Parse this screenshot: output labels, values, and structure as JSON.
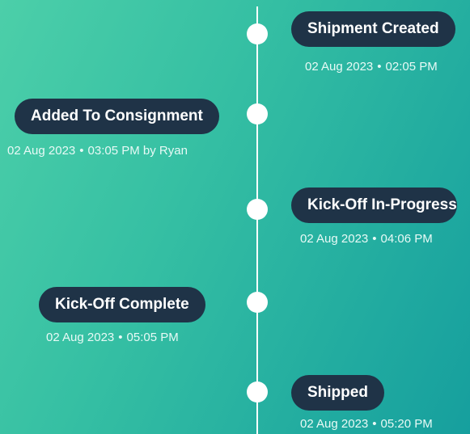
{
  "events": [
    {
      "status": "Shipment Created",
      "date": "02 Aug 2023",
      "time": "02:05 PM",
      "by": ""
    },
    {
      "status": "Added To Consignment",
      "date": "02 Aug 2023",
      "time": "03:05 PM",
      "by": "by Ryan"
    },
    {
      "status": "Kick-Off In-Progress",
      "date": "02 Aug 2023",
      "time": "04:06 PM",
      "by": ""
    },
    {
      "status": "Kick-Off Complete",
      "date": "02 Aug 2023",
      "time": "05:05 PM",
      "by": ""
    },
    {
      "status": "Shipped",
      "date": "02 Aug 2023",
      "time": "05:20 PM",
      "by": ""
    }
  ],
  "separator": "•",
  "colors": {
    "pill_bg": "#1f3347",
    "gradient_start": "#4ccfa9",
    "gradient_end": "#169f9e",
    "line": "#ffffff"
  }
}
